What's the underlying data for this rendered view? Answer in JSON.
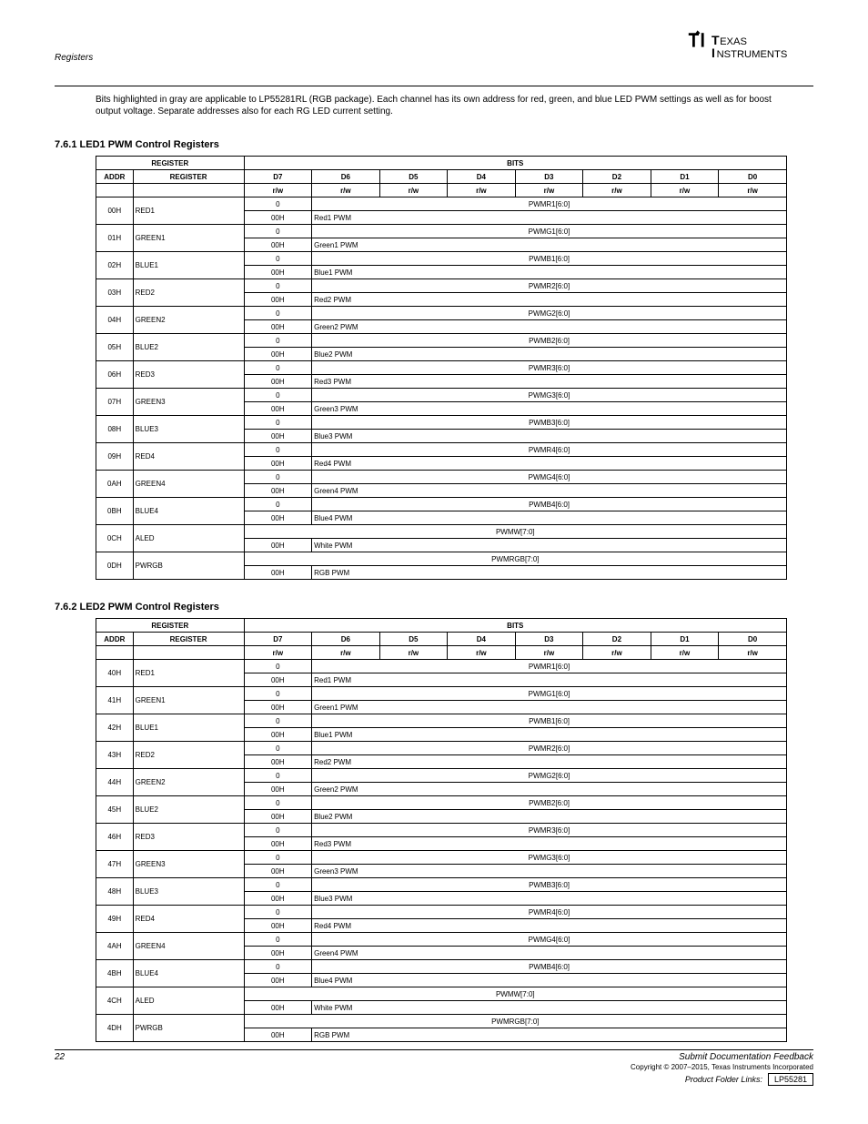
{
  "header": {
    "section_label": "Registers"
  },
  "logo_alt": "Texas Instruments",
  "intro": "Bits highlighted in gray are applicable to LP55281RL (RGB package). Each channel has its own address for red, green, and blue LED PWM settings as well as for boost output voltage. Separate addresses also for each RG LED current setting.",
  "section1": {
    "title": "7.6.1    LED1 PWM Control Registers",
    "table": {
      "title": "REGISTER",
      "bits_label": "BITS",
      "address_label": "ADDR",
      "register_label": "REGISTER",
      "bit_headers": [
        "D7",
        "D6",
        "D5",
        "D4",
        "D3",
        "D2",
        "D1",
        "D0"
      ],
      "rw_headers": [
        "r/w",
        "r/w",
        "r/w",
        "r/w",
        "r/w",
        "r/w",
        "r/w",
        "r/w"
      ],
      "rows": [
        {
          "addr": "00H",
          "reg": "RED1",
          "span": [
            {
              "w": 1,
              "t": "0"
            }
          ],
          "sym": "PWMR1[6:0]",
          "sym_w": 7,
          "def": "00H",
          "desc": "Red1 PWM"
        },
        {
          "addr": "01H",
          "reg": "GREEN1",
          "span": [
            {
              "w": 1,
              "t": "0"
            }
          ],
          "sym": "PWMG1[6:0]",
          "sym_w": 7,
          "def": "00H",
          "desc": "Green1 PWM"
        },
        {
          "addr": "02H",
          "reg": "BLUE1",
          "span": [
            {
              "w": 1,
              "t": "0"
            }
          ],
          "sym": "PWMB1[6:0]",
          "sym_w": 7,
          "def": "00H",
          "desc": "Blue1 PWM"
        },
        {
          "addr": "03H",
          "reg": "RED2",
          "span": [
            {
              "w": 1,
              "t": "0"
            }
          ],
          "sym": "PWMR2[6:0]",
          "sym_w": 7,
          "def": "00H",
          "desc": "Red2 PWM"
        },
        {
          "addr": "04H",
          "reg": "GREEN2",
          "span": [
            {
              "w": 1,
              "t": "0"
            }
          ],
          "sym": "PWMG2[6:0]",
          "sym_w": 7,
          "def": "00H",
          "desc": "Green2 PWM"
        },
        {
          "addr": "05H",
          "reg": "BLUE2",
          "span": [
            {
              "w": 1,
              "t": "0"
            }
          ],
          "sym": "PWMB2[6:0]",
          "sym_w": 7,
          "def": "00H",
          "desc": "Blue2 PWM"
        },
        {
          "addr": "06H",
          "reg": "RED3",
          "span": [
            {
              "w": 1,
              "t": "0"
            }
          ],
          "sym": "PWMR3[6:0]",
          "sym_w": 7,
          "def": "00H",
          "desc": "Red3 PWM"
        },
        {
          "addr": "07H",
          "reg": "GREEN3",
          "span": [
            {
              "w": 1,
              "t": "0"
            }
          ],
          "sym": "PWMG3[6:0]",
          "sym_w": 7,
          "def": "00H",
          "desc": "Green3 PWM"
        },
        {
          "addr": "08H",
          "reg": "BLUE3",
          "span": [
            {
              "w": 1,
              "t": "0"
            }
          ],
          "sym": "PWMB3[6:0]",
          "sym_w": 7,
          "def": "00H",
          "desc": "Blue3 PWM"
        },
        {
          "addr": "09H",
          "reg": "RED4",
          "span": [
            {
              "w": 1,
              "t": "0"
            }
          ],
          "sym": "PWMR4[6:0]",
          "sym_w": 7,
          "def": "00H",
          "desc": "Red4 PWM"
        },
        {
          "addr": "0AH",
          "reg": "GREEN4",
          "span": [
            {
              "w": 1,
              "t": "0"
            }
          ],
          "sym": "PWMG4[6:0]",
          "sym_w": 7,
          "def": "00H",
          "desc": "Green4 PWM"
        },
        {
          "addr": "0BH",
          "reg": "BLUE4",
          "span": [
            {
              "w": 1,
              "t": "0"
            }
          ],
          "sym": "PWMB4[6:0]",
          "sym_w": 7,
          "def": "00H",
          "desc": "Blue4 PWM"
        },
        {
          "addr": "0CH",
          "reg": "ALED",
          "span": [],
          "sym": "PWMW[7:0]",
          "sym_w": 8,
          "def": "00H",
          "desc": "White PWM"
        },
        {
          "addr": "0DH",
          "reg": "PWRGB",
          "span": [],
          "sym": "PWMRGB[7:0]",
          "sym_w": 8,
          "def": "00H",
          "desc": "RGB PWM"
        }
      ]
    }
  },
  "section2": {
    "title": "7.6.2    LED2 PWM Control Registers",
    "table": {
      "title": "REGISTER",
      "bits_label": "BITS",
      "address_label": "ADDR",
      "register_label": "REGISTER",
      "bit_headers": [
        "D7",
        "D6",
        "D5",
        "D4",
        "D3",
        "D2",
        "D1",
        "D0"
      ],
      "rw_headers": [
        "r/w",
        "r/w",
        "r/w",
        "r/w",
        "r/w",
        "r/w",
        "r/w",
        "r/w"
      ],
      "rows": [
        {
          "addr": "40H",
          "reg": "RED1",
          "span": [
            {
              "w": 1,
              "t": "0"
            }
          ],
          "sym": "PWMR1[6:0]",
          "sym_w": 7,
          "def": "00H",
          "desc": "Red1 PWM"
        },
        {
          "addr": "41H",
          "reg": "GREEN1",
          "span": [
            {
              "w": 1,
              "t": "0"
            }
          ],
          "sym": "PWMG1[6:0]",
          "sym_w": 7,
          "def": "00H",
          "desc": "Green1 PWM"
        },
        {
          "addr": "42H",
          "reg": "BLUE1",
          "span": [
            {
              "w": 1,
              "t": "0"
            }
          ],
          "sym": "PWMB1[6:0]",
          "sym_w": 7,
          "def": "00H",
          "desc": "Blue1 PWM"
        },
        {
          "addr": "43H",
          "reg": "RED2",
          "span": [
            {
              "w": 1,
              "t": "0"
            }
          ],
          "sym": "PWMR2[6:0]",
          "sym_w": 7,
          "def": "00H",
          "desc": "Red2 PWM"
        },
        {
          "addr": "44H",
          "reg": "GREEN2",
          "span": [
            {
              "w": 1,
              "t": "0"
            }
          ],
          "sym": "PWMG2[6:0]",
          "sym_w": 7,
          "def": "00H",
          "desc": "Green2 PWM"
        },
        {
          "addr": "45H",
          "reg": "BLUE2",
          "span": [
            {
              "w": 1,
              "t": "0"
            }
          ],
          "sym": "PWMB2[6:0]",
          "sym_w": 7,
          "def": "00H",
          "desc": "Blue2 PWM"
        },
        {
          "addr": "46H",
          "reg": "RED3",
          "span": [
            {
              "w": 1,
              "t": "0"
            }
          ],
          "sym": "PWMR3[6:0]",
          "sym_w": 7,
          "def": "00H",
          "desc": "Red3 PWM"
        },
        {
          "addr": "47H",
          "reg": "GREEN3",
          "span": [
            {
              "w": 1,
              "t": "0"
            }
          ],
          "sym": "PWMG3[6:0]",
          "sym_w": 7,
          "def": "00H",
          "desc": "Green3 PWM"
        },
        {
          "addr": "48H",
          "reg": "BLUE3",
          "span": [
            {
              "w": 1,
              "t": "0"
            }
          ],
          "sym": "PWMB3[6:0]",
          "sym_w": 7,
          "def": "00H",
          "desc": "Blue3 PWM"
        },
        {
          "addr": "49H",
          "reg": "RED4",
          "span": [
            {
              "w": 1,
              "t": "0"
            }
          ],
          "sym": "PWMR4[6:0]",
          "sym_w": 7,
          "def": "00H",
          "desc": "Red4 PWM"
        },
        {
          "addr": "4AH",
          "reg": "GREEN4",
          "span": [
            {
              "w": 1,
              "t": "0"
            }
          ],
          "sym": "PWMG4[6:0]",
          "sym_w": 7,
          "def": "00H",
          "desc": "Green4 PWM"
        },
        {
          "addr": "4BH",
          "reg": "BLUE4",
          "span": [
            {
              "w": 1,
              "t": "0"
            }
          ],
          "sym": "PWMB4[6:0]",
          "sym_w": 7,
          "def": "00H",
          "desc": "Blue4 PWM"
        },
        {
          "addr": "4CH",
          "reg": "ALED",
          "span": [],
          "sym": "PWMW[7:0]",
          "sym_w": 8,
          "def": "00H",
          "desc": "White PWM"
        },
        {
          "addr": "4DH",
          "reg": "PWRGB",
          "span": [],
          "sym": "PWMRGB[7:0]",
          "sym_w": 8,
          "def": "00H",
          "desc": "RGB PWM"
        }
      ]
    }
  },
  "footer": {
    "page": "22",
    "right": "Submit Documentation Feedback",
    "copyright": "Copyright © 2007–2015, Texas Instruments Incorporated",
    "product_label": "Product Folder Links:",
    "product": "LP55281"
  }
}
